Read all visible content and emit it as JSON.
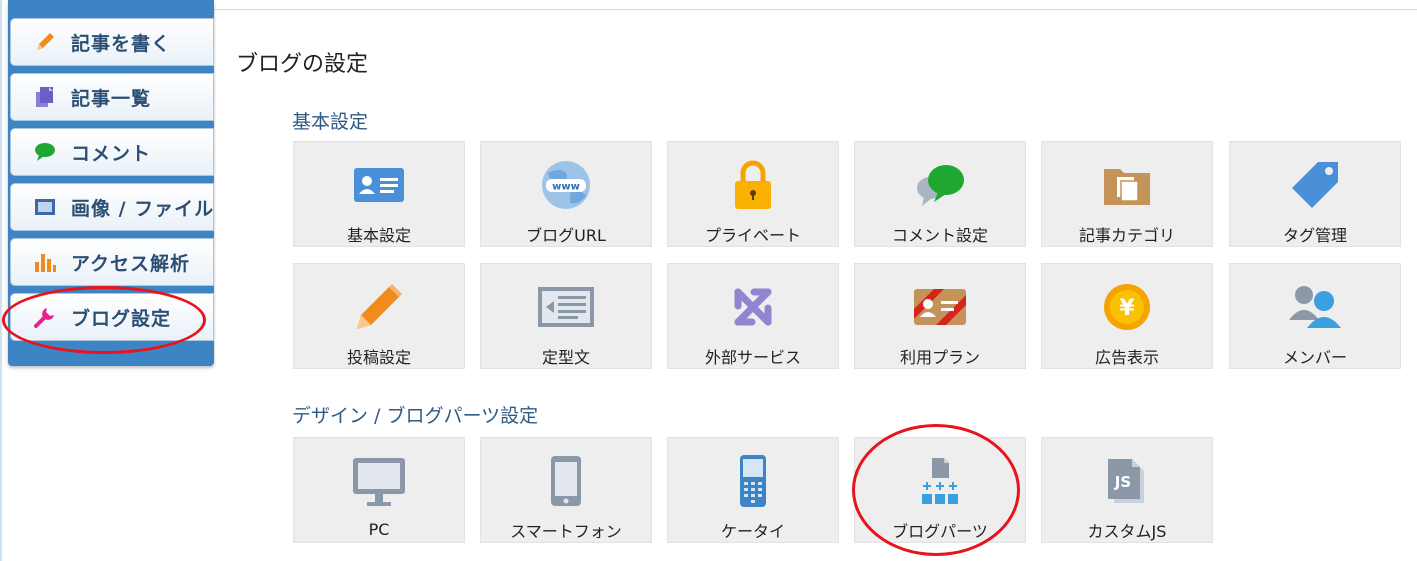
{
  "sidebar": {
    "items": [
      {
        "label": "記事を書く",
        "icon": "pencil-icon"
      },
      {
        "label": "記事一覧",
        "icon": "document-icon"
      },
      {
        "label": "コメント",
        "icon": "speech-bubble-icon"
      },
      {
        "label": "画像 / ファイル",
        "icon": "image-icon"
      },
      {
        "label": "アクセス解析",
        "icon": "bar-chart-icon"
      },
      {
        "label": "ブログ設定",
        "icon": "wrench-icon"
      }
    ]
  },
  "main": {
    "title": "ブログの設定",
    "basic": {
      "title": "基本設定",
      "tiles": [
        {
          "label": "基本設定",
          "icon": "id-card-icon"
        },
        {
          "label": "ブログURL",
          "icon": "globe-www-icon"
        },
        {
          "label": "プライベート",
          "icon": "padlock-icon"
        },
        {
          "label": "コメント設定",
          "icon": "comment-bubbles-icon"
        },
        {
          "label": "記事カテゴリ",
          "icon": "folder-icon"
        },
        {
          "label": "タグ管理",
          "icon": "tag-icon"
        },
        {
          "label": "投稿設定",
          "icon": "pencil-icon"
        },
        {
          "label": "定型文",
          "icon": "template-text-icon"
        },
        {
          "label": "外部サービス",
          "icon": "external-service-icon"
        },
        {
          "label": "利用プラン",
          "icon": "plan-card-icon"
        },
        {
          "label": "広告表示",
          "icon": "yen-coin-icon"
        },
        {
          "label": "メンバー",
          "icon": "members-icon"
        }
      ]
    },
    "design": {
      "title": "デザイン / ブログパーツ設定",
      "tiles": [
        {
          "label": "PC",
          "icon": "monitor-icon"
        },
        {
          "label": "スマートフォン",
          "icon": "smartphone-icon"
        },
        {
          "label": "ケータイ",
          "icon": "feature-phone-icon"
        },
        {
          "label": "ブログパーツ",
          "icon": "blog-parts-icon"
        },
        {
          "label": "カスタムJS",
          "icon": "js-file-icon"
        }
      ]
    }
  },
  "colors": {
    "sidebar": "#3d84c4",
    "accent_blue": "#4a90d9",
    "highlight_red": "#e8141c",
    "tile_bg": "#eeeeee"
  }
}
